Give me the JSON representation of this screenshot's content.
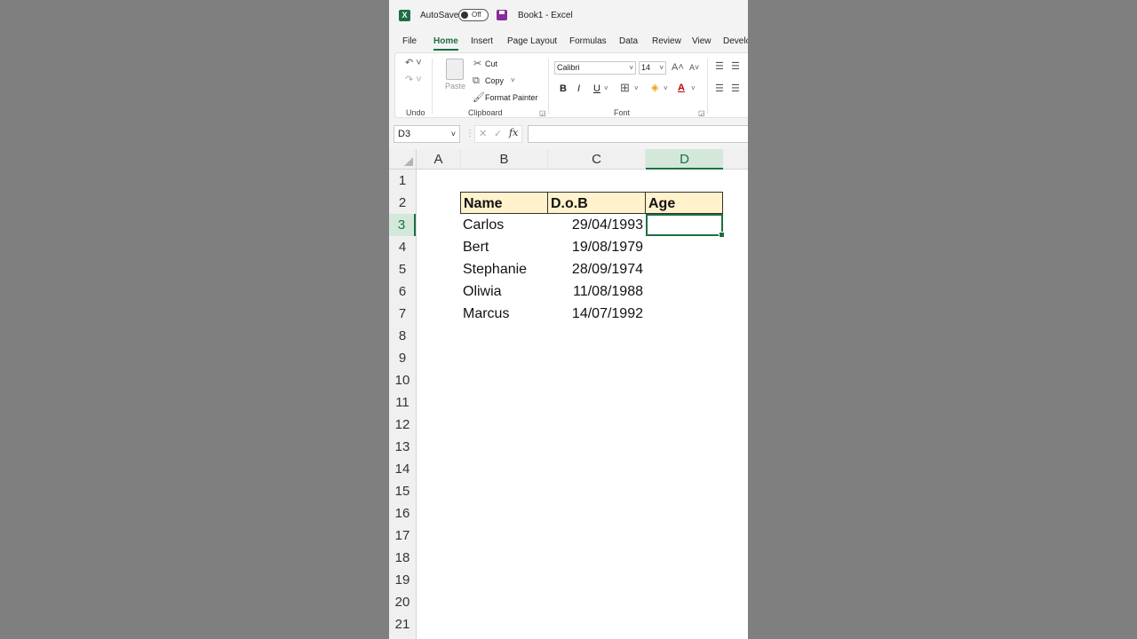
{
  "titlebar": {
    "autosave_label": "AutoSave",
    "autosave_state": "Off",
    "doc_title": "Book1  -  Excel"
  },
  "tabs": [
    "File",
    "Home",
    "Insert",
    "Page Layout",
    "Formulas",
    "Data",
    "Review",
    "View",
    "Develo"
  ],
  "ribbon": {
    "undo_label": "Undo",
    "paste_label": "Paste",
    "cut_label": "Cut",
    "copy_label": "Copy",
    "format_painter_label": "Format Painter",
    "clipboard_label": "Clipboard",
    "font_name": "Calibri",
    "font_size": "14",
    "font_label": "Font",
    "bold": "B",
    "italic": "I",
    "underline": "U"
  },
  "formula_bar": {
    "name_box": "D3",
    "fx": "fx",
    "formula": ""
  },
  "columns": [
    "A",
    "B",
    "C",
    "D"
  ],
  "rows": [
    "1",
    "2",
    "3",
    "4",
    "5",
    "6",
    "7",
    "8",
    "9",
    "10",
    "11",
    "12",
    "13",
    "14",
    "15",
    "16",
    "17",
    "18",
    "19",
    "20",
    "21"
  ],
  "table": {
    "headers": [
      "Name",
      "D.o.B",
      "Age"
    ],
    "rows": [
      [
        "Carlos",
        "29/04/1993",
        ""
      ],
      [
        "Bert",
        "19/08/1979",
        ""
      ],
      [
        "Stephanie",
        "28/09/1974",
        ""
      ],
      [
        "Oliwia",
        "11/08/1988",
        ""
      ],
      [
        "Marcus",
        "14/07/1992",
        ""
      ]
    ]
  },
  "colors": {
    "accent": "#1d6f42",
    "header_fill": "#fff2cc",
    "background": "#7f7f7f"
  }
}
